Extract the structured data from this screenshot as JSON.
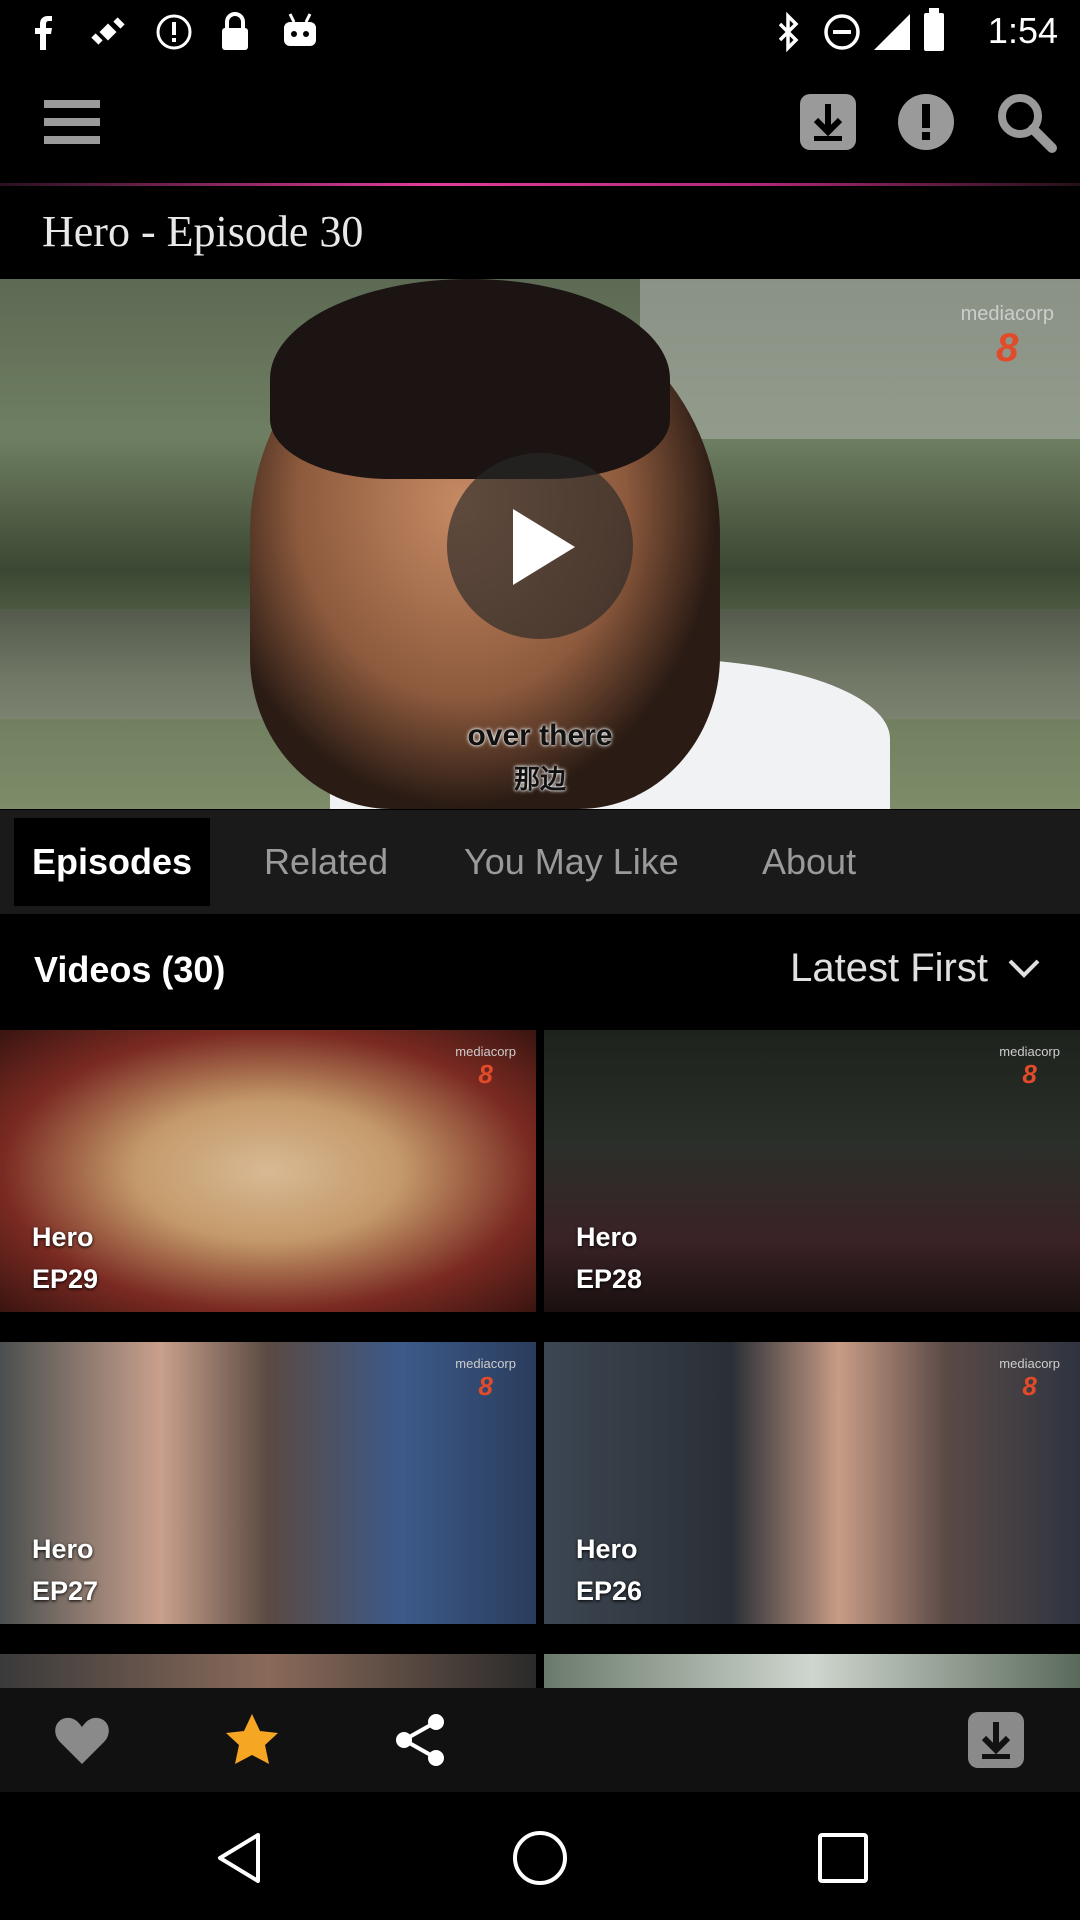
{
  "status_bar": {
    "time": "1:54",
    "left_icons": [
      "facebook-icon",
      "satellite-icon",
      "alert-icon",
      "lock-icon",
      "android-icon"
    ],
    "right_icons": [
      "bluetooth-icon",
      "do-not-disturb-icon",
      "signal-icon",
      "battery-icon"
    ]
  },
  "app_bar": {
    "icons": [
      "menu-icon",
      "download-icon",
      "info-icon",
      "search-icon"
    ],
    "accent": "#e23d9c"
  },
  "page": {
    "title": "Hero - Episode 30"
  },
  "player": {
    "subtitle_en": "over there",
    "subtitle_zh": "那边",
    "watermark_text": "mediacorp",
    "watermark_channel": "8"
  },
  "tabs": [
    {
      "label": "Episodes",
      "active": true
    },
    {
      "label": "Related",
      "active": false
    },
    {
      "label": "You May Like",
      "active": false
    },
    {
      "label": "About",
      "active": false
    }
  ],
  "videos": {
    "count_label": "Videos (30)",
    "sort_selected": "Latest First",
    "items": [
      {
        "title": "Hero",
        "episode": "EP29"
      },
      {
        "title": "Hero",
        "episode": "EP28"
      },
      {
        "title": "Hero",
        "episode": "EP27"
      },
      {
        "title": "Hero",
        "episode": "EP26"
      }
    ],
    "logo_text": "mediacorp",
    "logo_channel": "8"
  },
  "bottom_actions": {
    "icons": [
      "heart-icon",
      "star-icon",
      "share-icon",
      "download-icon"
    ],
    "star_color": "#f5a623"
  },
  "nav_bar": {
    "icons": [
      "back-icon",
      "home-icon",
      "recents-icon"
    ]
  }
}
